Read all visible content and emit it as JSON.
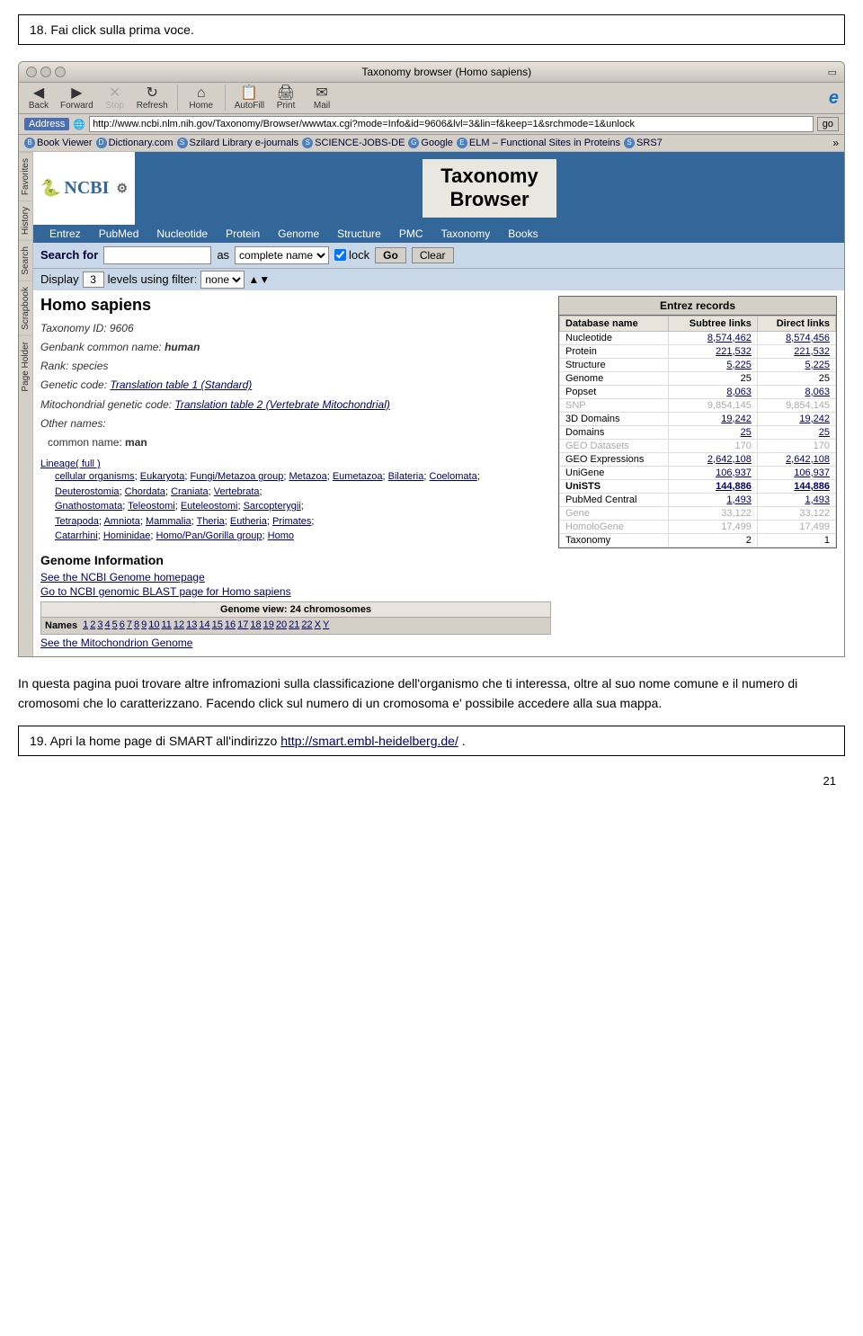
{
  "instruction18": {
    "text": "18. Fai click sulla prima voce."
  },
  "browser": {
    "title": "Taxonomy browser (Homo sapiens)",
    "titlebar_controls": [
      "dot1",
      "dot2",
      "dot3"
    ],
    "toolbar": {
      "buttons": [
        {
          "label": "Back",
          "icon": "◀",
          "disabled": false
        },
        {
          "label": "Forward",
          "icon": "▶",
          "disabled": false
        },
        {
          "label": "Stop",
          "icon": "✕",
          "disabled": false
        },
        {
          "label": "Refresh",
          "icon": "↻",
          "disabled": false
        },
        {
          "label": "Home",
          "icon": "⌂",
          "disabled": false
        },
        {
          "label": "AutoFill",
          "icon": "📋",
          "disabled": false
        },
        {
          "label": "Print",
          "icon": "🖨",
          "disabled": false
        },
        {
          "label": "Mail",
          "icon": "✉",
          "disabled": false
        }
      ]
    },
    "address": {
      "label": "Address",
      "url": "http://www.ncbi.nlm.nih.gov/Taxonomy/Browser/wwwtax.cgi?mode=Info&id=9606&lvl=3&lin=f&keep=1&srchmode=1&unlock",
      "go_label": "go"
    },
    "bookmarks": [
      {
        "label": "Book Viewer"
      },
      {
        "label": "Dictionary.com"
      },
      {
        "label": "Szilard Library e-journals"
      },
      {
        "label": "SCIENCE-JOBS-DE"
      },
      {
        "label": "Google"
      },
      {
        "label": "ELM – Functional Sites in Proteins"
      },
      {
        "label": "SRS7"
      }
    ],
    "sidebar_tabs": [
      "Favorites",
      "History",
      "Search",
      "Scrapbook",
      "Page Holder"
    ]
  },
  "ncbi": {
    "logo": "NCBI",
    "taxonomy_title": "Taxonomy\nBrowser",
    "nav_items": [
      "Entrez",
      "PubMed",
      "Nucleotide",
      "Protein",
      "Genome",
      "Structure",
      "PMC",
      "Taxonomy",
      "Books"
    ],
    "search": {
      "label": "Search for",
      "placeholder": "",
      "as_label": "as",
      "select_options": [
        "complete name"
      ],
      "lock_label": "lock",
      "go_label": "Go",
      "clear_label": "Clear"
    },
    "display": {
      "label": "Display",
      "number": "3",
      "levels_label": "levels using filter:",
      "filter_options": [
        "none"
      ]
    }
  },
  "organism": {
    "name": "Homo sapiens",
    "taxonomy_id": "9606",
    "genbank_name": "human",
    "rank": "species",
    "genetic_code": "Translation table 1 (Standard)",
    "mito_genetic_code": "Translation table 2 (Vertebrate Mitochondrial)",
    "other_names_label": "Other names:",
    "common_name": "man",
    "lineage_label": "Lineage( full )",
    "lineage_items": [
      "cellular organisms",
      "Eukaryota",
      "Fungi/Metazoa group",
      "Metazoa",
      "Eumetazoa",
      "Bilateria",
      "Coelomata",
      "Deuterostomia",
      "Chordata",
      "Craniata",
      "Vertebrata",
      "Gnathostomata",
      "Teleostomi",
      "Euteleostomi",
      "Sarcopterygii",
      "Tetrapoda",
      "Amniota",
      "Mammalia",
      "Theria",
      "Eutheria",
      "Primates",
      "Catarrhini",
      "Hominidae",
      "Homo/Pan/Gorilla group",
      "Homo"
    ]
  },
  "entrez_records": {
    "title": "Entrez records",
    "headers": [
      "Database name",
      "Subtree links",
      "Direct links"
    ],
    "rows": [
      {
        "name": "Nucleotide",
        "subtree": "8,574,462",
        "direct": "8,574,456",
        "greyed": false,
        "linked": true
      },
      {
        "name": "Protein",
        "subtree": "221,532",
        "direct": "221,532",
        "greyed": false,
        "linked": true
      },
      {
        "name": "Structure",
        "subtree": "5,225",
        "direct": "5,225",
        "greyed": false,
        "linked": true
      },
      {
        "name": "Genome",
        "subtree": "25",
        "direct": "25",
        "greyed": false,
        "linked": false
      },
      {
        "name": "Popset",
        "subtree": "8,063",
        "direct": "8,063",
        "greyed": false,
        "linked": true
      },
      {
        "name": "SNP",
        "subtree": "9,854,145",
        "direct": "9,854,145",
        "greyed": true,
        "linked": false
      },
      {
        "name": "3D Domains",
        "subtree": "19,242",
        "direct": "19,242",
        "greyed": false,
        "linked": true
      },
      {
        "name": "Domains",
        "subtree": "25",
        "direct": "25",
        "greyed": false,
        "linked": true
      },
      {
        "name": "GEO Datasets",
        "subtree": "170",
        "direct": "170",
        "greyed": true,
        "linked": false
      },
      {
        "name": "GEO Expressions",
        "subtree": "2,642,108",
        "direct": "2,642,108",
        "greyed": false,
        "linked": true
      },
      {
        "name": "UniGene",
        "subtree": "106,937",
        "direct": "106,937",
        "greyed": false,
        "linked": true
      },
      {
        "name": "UniSTS",
        "subtree": "144,886",
        "direct": "144,886",
        "greyed": false,
        "linked": true
      },
      {
        "name": "PubMed Central",
        "subtree": "1,493",
        "direct": "1,493",
        "greyed": false,
        "linked": true
      },
      {
        "name": "Gene",
        "subtree": "33,122",
        "direct": "33,122",
        "greyed": true,
        "linked": false
      },
      {
        "name": "HomoloGene",
        "subtree": "17,499",
        "direct": "17,499",
        "greyed": true,
        "linked": false
      },
      {
        "name": "Taxonomy",
        "subtree": "2",
        "direct": "1",
        "greyed": false,
        "linked": false
      }
    ]
  },
  "genome_section": {
    "title": "Genome Information",
    "link1": "See the NCBI Genome homepage",
    "link2": "Go to NCBI genomic BLAST page for Homo sapiens",
    "view_header": "Genome view: 24 chromosomes",
    "names_label": "Names",
    "chromosomes": [
      "1",
      "2",
      "3",
      "4",
      "5",
      "6",
      "7",
      "8",
      "9",
      "10",
      "11",
      "12",
      "13",
      "14",
      "15",
      "16",
      "17",
      "18",
      "19",
      "20",
      "21",
      "22",
      "X",
      "Y"
    ],
    "mito_link": "See the Mitochondrion Genome"
  },
  "description": {
    "text": "In questa pagina puoi trovare altre infromazioni sulla classificazione dell'organismo che ti interessa, oltre al suo nome comune e il numero di cromosomi che lo caratterizzano. Facendo click sul numero di un cromosoma e' possibile accedere alla sua mappa."
  },
  "instruction19": {
    "text": "19. Apri la home page di SMART all'indirizzo",
    "link_text": "http://smart.embl-heidelberg.de/",
    "link_href": "http://smart.embl-heidelberg.de/",
    "suffix": " ."
  },
  "page_number": "21"
}
